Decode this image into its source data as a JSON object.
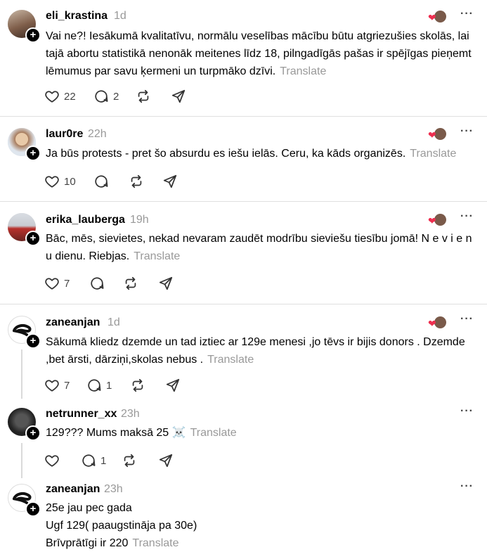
{
  "translate_label": "Translate",
  "posts": [
    {
      "username": "eli_krastina",
      "time": "1d",
      "text": "Vai ne?! Iesākumā kvalitatīvu, normālu veselības mācību būtu atgriezušies skolās, lai tajā abortu statistikā nenonāk meitenes līdz 18, pilngadīgās pašas ir spējīgas pieņemt lēmumus par savu ķermeni un turpmāko dzīvi.",
      "likes": "22",
      "replies": "2"
    },
    {
      "username": "laur0re",
      "time": "22h",
      "text": "Ja būs protests - pret šo absurdu es iešu ielās. Ceru, ka kāds organizēs.",
      "likes": "10",
      "replies": ""
    },
    {
      "username": "erika_lauberga",
      "time": "19h",
      "text": "Bāc, mēs, sievietes, nekad nevaram zaudēt modrību sieviešu tiesību jomā! N e v i e n u dienu. Riebjas.",
      "likes": "7",
      "replies": ""
    },
    {
      "username": "zaneanjan",
      "time": "1d",
      "text": "Sākumā kliedz dzemde un tad iztiec ar 129e menesi ,jo tēvs ir bijis donors . Dzemde ,bet ārsti, dārziņi,skolas nebus .",
      "likes": "7",
      "replies": "1"
    },
    {
      "username": "netrunner_xx",
      "time": "23h",
      "text": "129??? Mums maksā 25 ☠️",
      "likes": "",
      "replies": "1"
    },
    {
      "username": "zaneanjan",
      "time": "23h",
      "text_lines": [
        "25e jau pec gada",
        "Ugf 129( paaugstināja pa 30e)",
        "Brīvprātīgi ir 220"
      ]
    }
  ],
  "colors": {
    "heart": "#ee2e4f",
    "muted": "#999999",
    "divider": "#e0e0e0"
  }
}
